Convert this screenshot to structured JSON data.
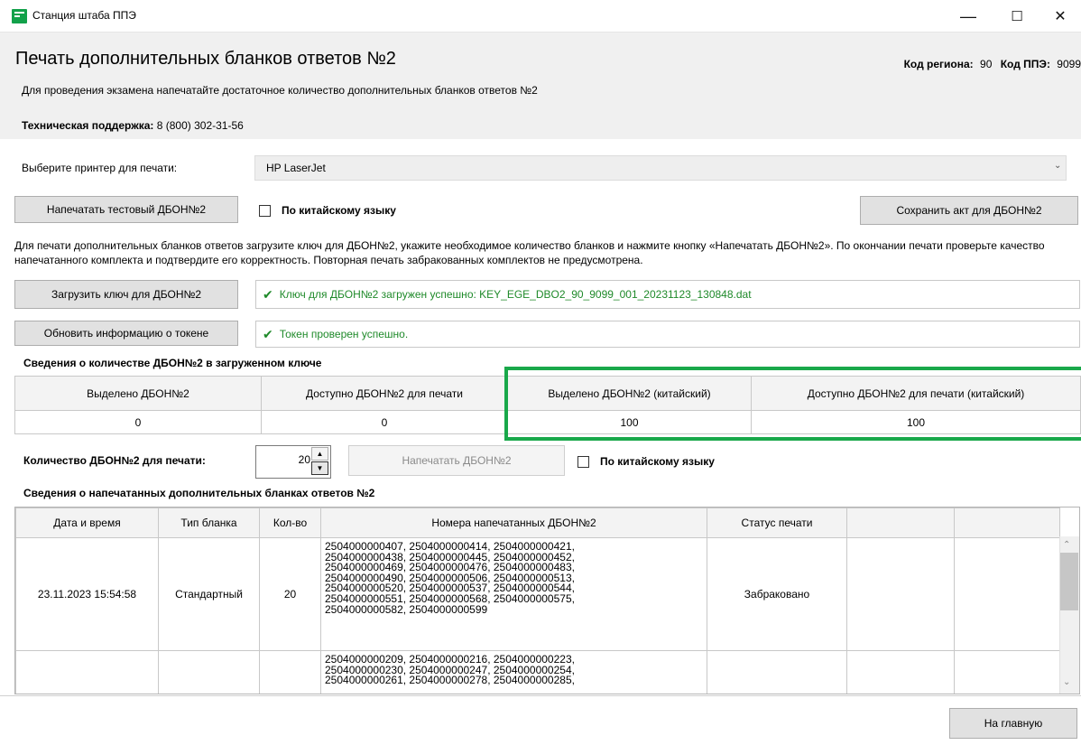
{
  "window": {
    "title": "Станция штаба ППЭ",
    "minimize": "—",
    "maximize": "☐",
    "close": "✕"
  },
  "header": {
    "page_title": "Печать дополнительных бланков ответов №2",
    "region_label": "Код региона:",
    "region_value": "90",
    "ppe_label": "Код ППЭ:",
    "ppe_value": "9099",
    "intro": "Для проведения экзамена напечатайте достаточное количество дополнительных бланков ответов №2",
    "support_label": "Техническая поддержка:",
    "support_phone": "8 (800) 302-31-56"
  },
  "printer": {
    "label": "Выберите принтер для печати:",
    "selected": "HP LaserJet"
  },
  "toolbar": {
    "test_print_label": "Напечатать тестовый ДБОН№2",
    "chinese_label": "По китайскому языку",
    "chinese_checked": false,
    "save_act_label": "Сохранить акт для ДБОН№2"
  },
  "instruction": "Для печати дополнительных бланков ответов загрузите ключ для ДБОН№2, укажите необходимое количество бланков и нажмите кнопку «Напечатать ДБОН№2». По окончании печати проверьте качество напечатанного комплекта и подтвердите его корректность. Повторная печать забракованных комплектов не предусмотрена.",
  "key": {
    "load_label": "Загрузить ключ для ДБОН№2",
    "status": "Ключ для ДБОН№2 загружен успешно: KEY_EGE_DBO2_90_9099_001_20231123_130848.dat"
  },
  "token": {
    "refresh_label": "Обновить информацию о токене",
    "status": "Токен проверен успешно."
  },
  "key_info": {
    "section_title": "Сведения о количестве ДБОН№2 в загруженном ключе",
    "headers": [
      "Выделено ДБОН№2",
      "Доступно ДБОН№2 для печати",
      "Выделено ДБОН№2 (китайский)",
      "Доступно ДБОН№2 для печати (китайский)"
    ],
    "values": [
      "0",
      "0",
      "100",
      "100"
    ]
  },
  "print": {
    "qty_label": "Количество ДБОН№2 для печати:",
    "qty_value": "20",
    "print_label": "Напечатать ДБОН№2",
    "chinese_label": "По китайскому языку",
    "chinese_checked": false
  },
  "history": {
    "section_title": "Сведения о напечатанных дополнительных бланках ответов №2",
    "headers": [
      "Дата и время",
      "Тип бланка",
      "Кол-во",
      "Номера напечатанных ДБОН№2",
      "Статус печати",
      "",
      ""
    ],
    "rows": [
      {
        "datetime": "23.11.2023 15:54:58",
        "type": "Стандартный",
        "count": "20",
        "numbers": [
          "2504000000407, 2504000000414, 2504000000421,",
          "2504000000438, 2504000000445, 2504000000452,",
          "2504000000469, 2504000000476, 2504000000483,",
          "2504000000490, 2504000000506, 2504000000513,",
          "2504000000520, 2504000000537, 2504000000544,",
          "2504000000551, 2504000000568, 2504000000575,",
          "2504000000582, 2504000000599"
        ],
        "status": "Забраковано"
      },
      {
        "datetime": "",
        "type": "",
        "count": "",
        "numbers": [
          "2504000000209, 2504000000216, 2504000000223,",
          "2504000000230, 2504000000247, 2504000000254,",
          "2504000000261, 2504000000278, 2504000000285,"
        ],
        "status": ""
      }
    ]
  },
  "footer": {
    "home_label": "На главную"
  },
  "colors": {
    "accent_green": "#19a84a",
    "status_green": "#1f8a2a",
    "header_bg": "#f0f0f0"
  }
}
